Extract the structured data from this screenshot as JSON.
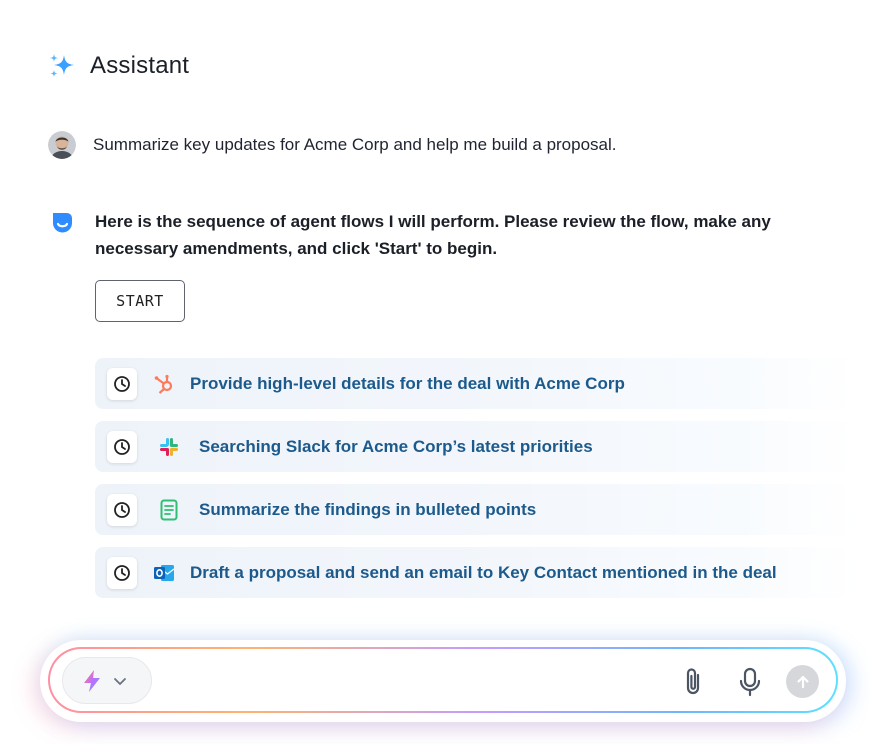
{
  "header": {
    "title": "Assistant",
    "icon": "sparkle-icon"
  },
  "user_message": {
    "text": "Summarize key updates for Acme Corp and help me build a proposal."
  },
  "assistant_message": {
    "text": "Here is the sequence of agent flows I will perform. Please review the flow, make any necessary amendments, and click 'Start' to begin."
  },
  "start_button": {
    "label": "START"
  },
  "flows": [
    {
      "label": "Provide high-level details for the deal with Acme Corp",
      "app": "hubspot-icon"
    },
    {
      "label": "Searching Slack for Acme Corp’s latest priorities",
      "app": "slack-icon"
    },
    {
      "label": "Summarize the findings in bulleted points",
      "app": "document-icon"
    },
    {
      "label": "Draft a proposal and send an email to Key Contact mentioned in the deal",
      "app": "outlook-icon"
    }
  ],
  "input_bar": {
    "mode_icon": "lightning-icon"
  },
  "colors": {
    "accent": "#1d5a8c",
    "sparkle": "#3aa0ff",
    "hubspot": "#ff7a59",
    "doc": "#2fbf71",
    "outlook": "#1976d2"
  }
}
